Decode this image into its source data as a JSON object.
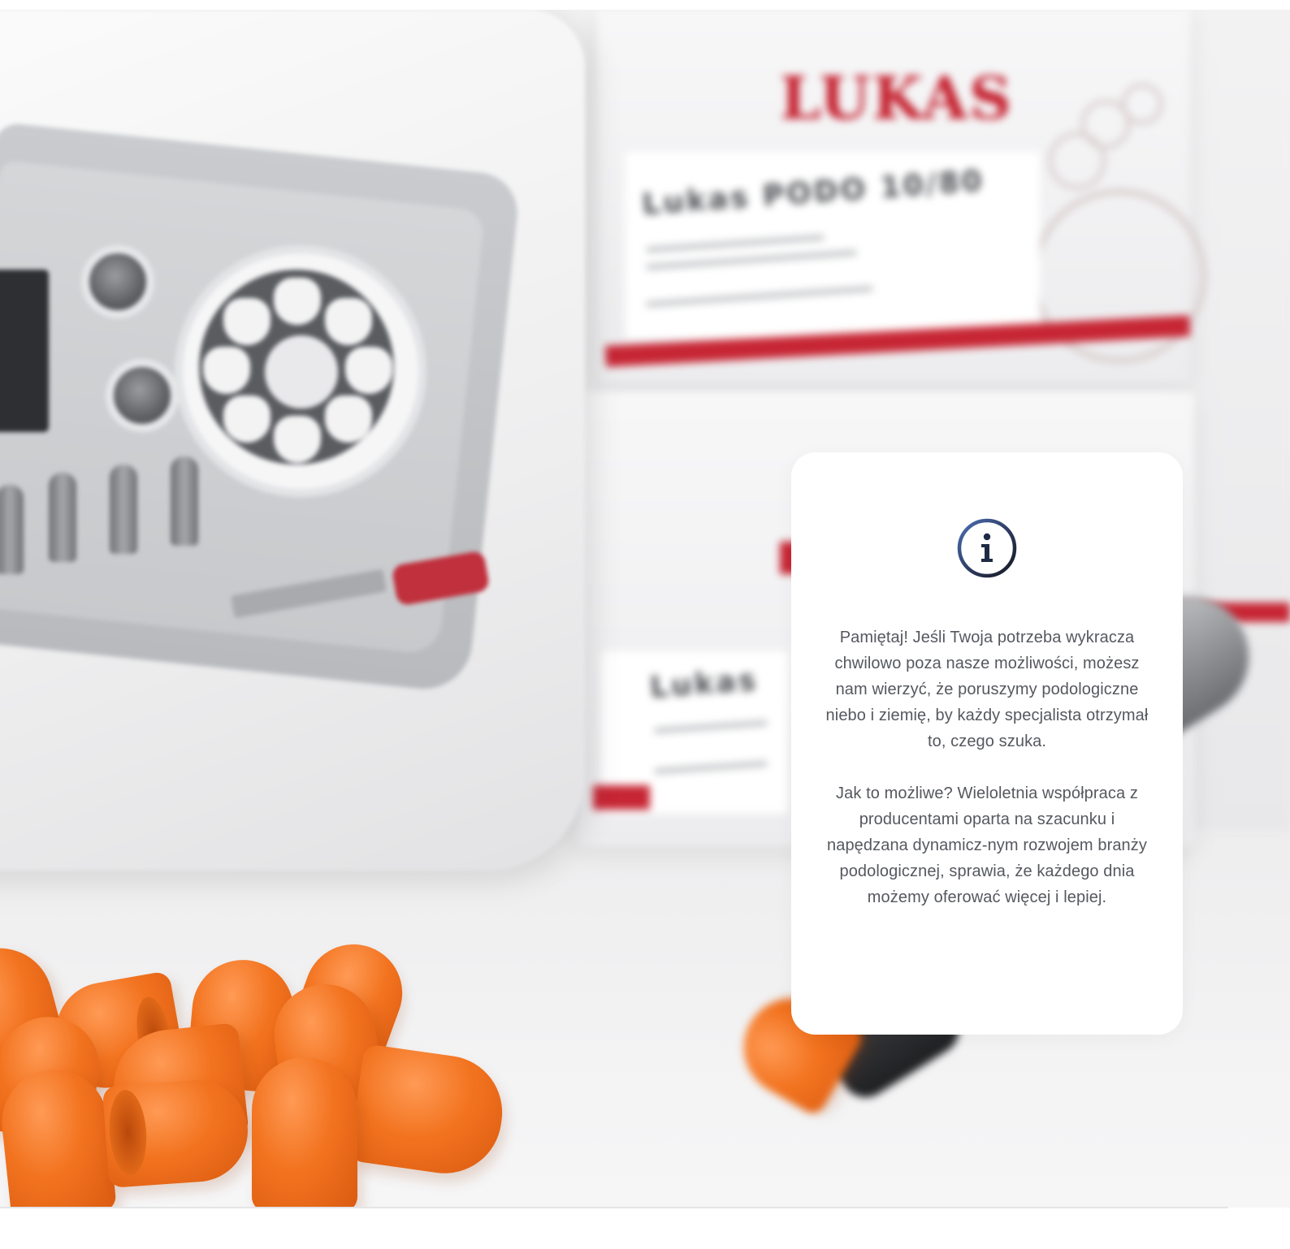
{
  "hero": {
    "brand": "LUKAS",
    "box_title": "Lukas PODO 10/80",
    "box_title_short": "Lukas"
  },
  "info_card": {
    "icon": "info-icon",
    "paragraphs": [
      "Pamiętaj! Jeśli Twoja potrzeba wykracza chwilowo poza nasze możliwości, możesz nam wierzyć, że poruszymy podologiczne niebo i ziemię, by każdy specjalista otrzymał to, czego szuka.",
      "Jak to możliwe? Wieloletnia współpraca z producentami oparta na szacunku i napędzana dynamicz-nym rozwojem branży podologicznej, sprawia, że każdego dnia możemy oferować więcej i lepiej."
    ]
  },
  "colors": {
    "brand_red": "#c41e2c",
    "orange": "#f2731f",
    "text_gray": "#55585e",
    "icon_dark": "#1f2a44",
    "icon_blue": "#4a6fb3"
  }
}
